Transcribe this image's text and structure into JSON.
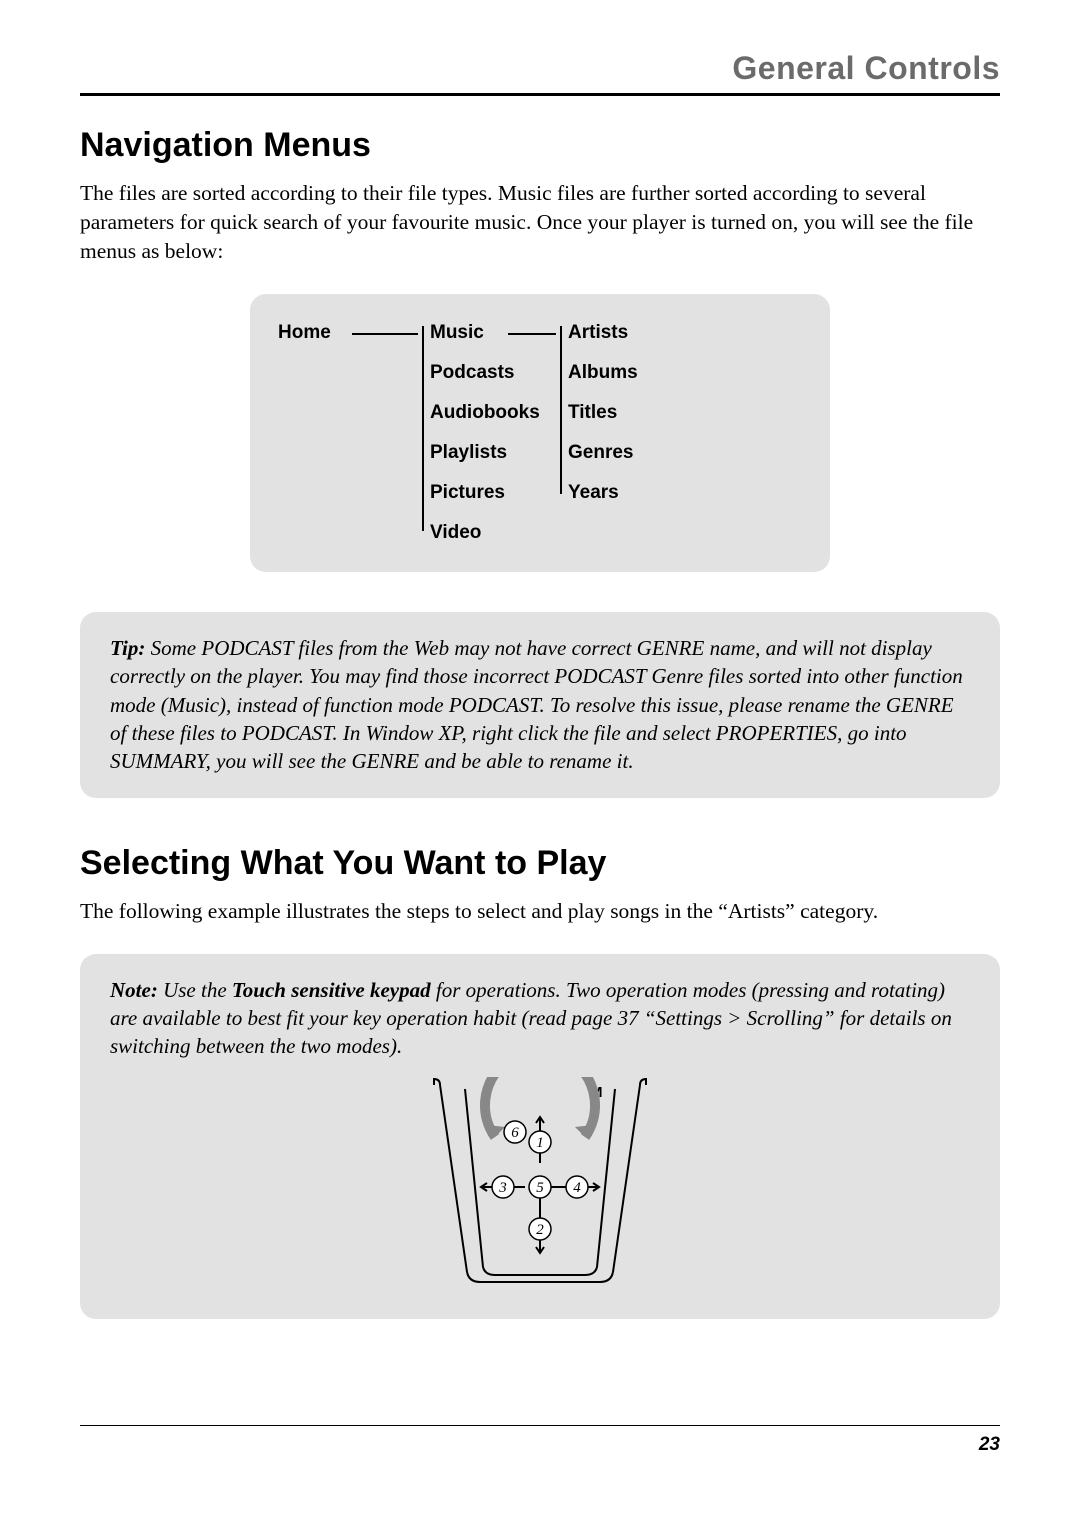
{
  "chapter_title": "General Controls",
  "section1": {
    "heading": "Navigation Menus",
    "paragraph": "The files are sorted according to their file types. Music files are further sorted according to several parameters for quick search of your favourite music. Once your player is turned on, you will see the file menus as below:"
  },
  "menu": {
    "root": "Home",
    "level1": [
      "Music",
      "Podcasts",
      "Audiobooks",
      "Playlists",
      "Pictures",
      "Video"
    ],
    "level2": [
      "Artists",
      "Albums",
      "Titles",
      "Genres",
      "Years"
    ]
  },
  "tip": {
    "label": "Tip:",
    "text": " Some PODCAST files from the Web may not have correct GENRE name, and will not display correctly on the player. You may find those incorrect PODCAST Genre files sorted into other function mode (Music), instead of function mode PODCAST. To resolve this issue, please rename the GENRE of these files to PODCAST. In Window XP, right click the file and select PROPERTIES, go into SUMMARY, you will see the GENRE and be able to rename it."
  },
  "section2": {
    "heading": "Selecting What You Want to Play",
    "paragraph": "The following example illustrates the steps to select and play songs in the “Artists” category."
  },
  "note": {
    "label": "Note:",
    "text_pre": " Use the ",
    "text_bold": "Touch sensitive keypad",
    "text_post": " for operations. Two operation modes (pressing and rotating) are available to best fit your key operation habit (read page 37 “Settings > Scrolling” for details on switching between the two modes)."
  },
  "keypad": {
    "m_label": "M",
    "numbers": [
      "1",
      "2",
      "3",
      "4",
      "5",
      "6"
    ]
  },
  "page_number": "23"
}
